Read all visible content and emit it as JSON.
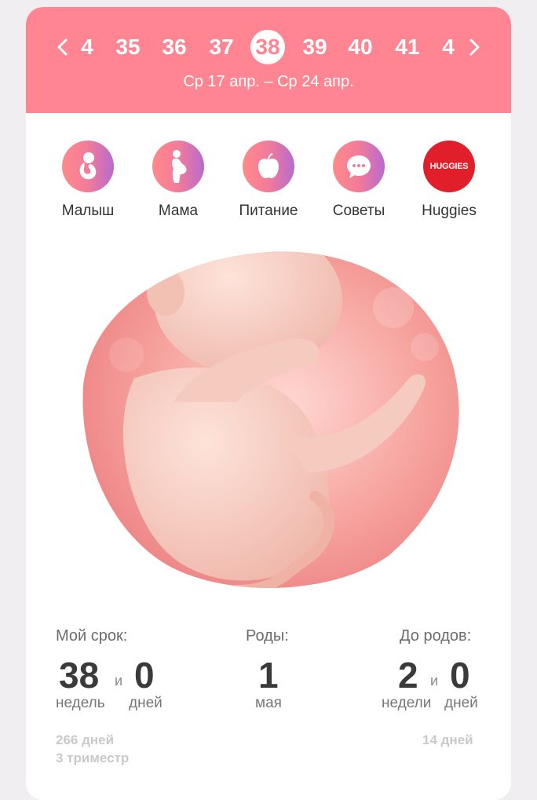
{
  "week_nav": {
    "weeks": [
      "4",
      "35",
      "36",
      "37",
      "38",
      "39",
      "40",
      "41",
      "4"
    ],
    "selected": "38",
    "date_range": "Ср 17 апр. – Ср 24 апр."
  },
  "categories": [
    {
      "label": "Малыш",
      "icon": "baby-icon"
    },
    {
      "label": "Мама",
      "icon": "pregnant-woman-icon"
    },
    {
      "label": "Питание",
      "icon": "apple-icon"
    },
    {
      "label": "Советы",
      "icon": "chat-bubble-icon"
    },
    {
      "label": "Huggies",
      "icon": "huggies-logo",
      "logo_text": "HUGGIES"
    }
  ],
  "stats": {
    "term": {
      "label": "Мой срок:",
      "weeks": "38",
      "and": "и",
      "days": "0",
      "weeks_unit": "недель",
      "days_unit": "дней",
      "total_days": "266 дней",
      "trimester": "3 триместр"
    },
    "birth": {
      "label": "Роды:",
      "day": "1",
      "month": "мая"
    },
    "remaining": {
      "label": "До родов:",
      "weeks": "2",
      "and": "и",
      "days": "0",
      "weeks_unit": "недели",
      "days_unit": "дней",
      "total_days": "14 дней"
    }
  },
  "colors": {
    "accent": "#ff8592",
    "huggies_red": "#e01f2b",
    "text_dark": "#3a3a3a"
  }
}
